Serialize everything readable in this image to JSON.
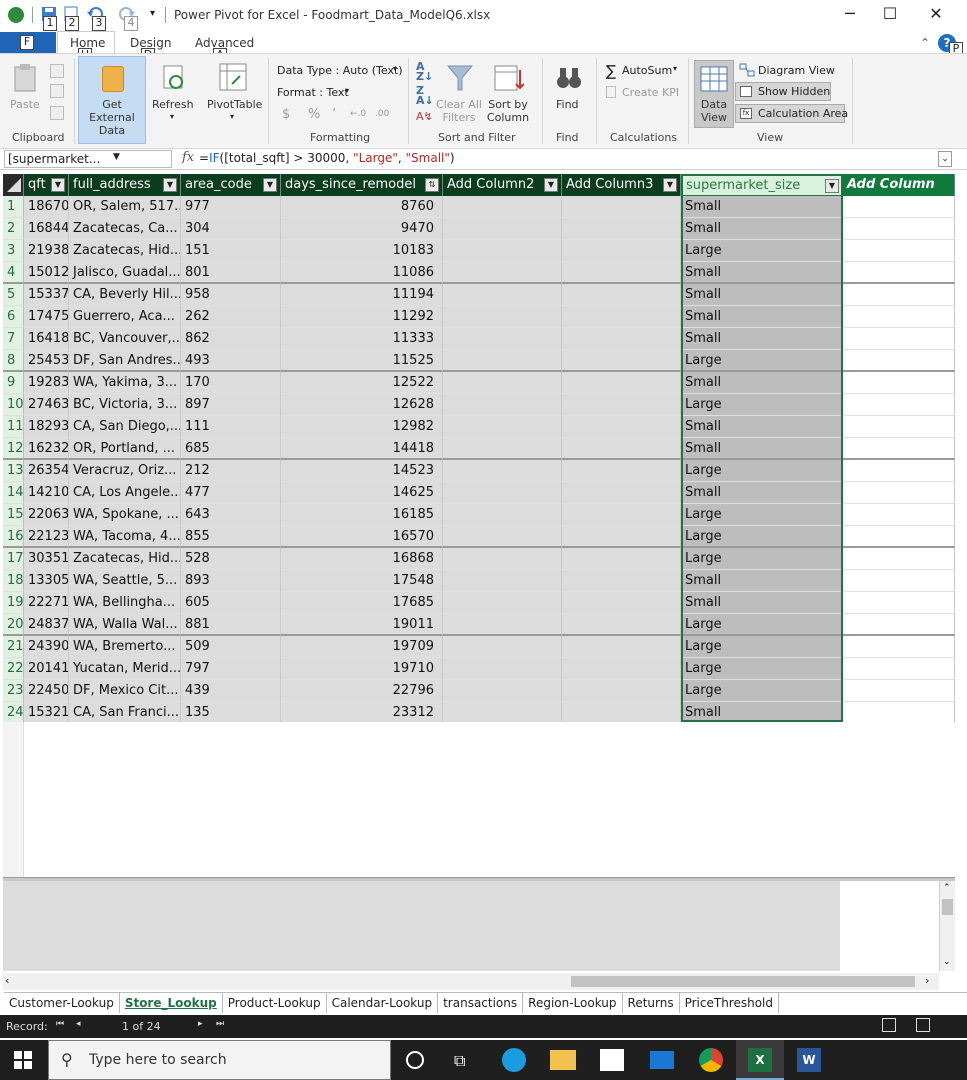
{
  "window": {
    "title": "Power Pivot for Excel - Foodmart_Data_ModelQ6.xlsx",
    "keytips": [
      "1",
      "2",
      "3",
      "4"
    ],
    "controls": {
      "minimize": "─",
      "maximize": "☐",
      "close": "✕"
    }
  },
  "tabs": {
    "file": "F",
    "items": [
      {
        "label": "Home",
        "keytip": "H"
      },
      {
        "label": "Design",
        "keytip": "D"
      },
      {
        "label": "Advanced",
        "keytip": "A"
      }
    ],
    "help_keytip": "P"
  },
  "ribbon": {
    "clipboard": {
      "paste": "Paste",
      "group": "Clipboard"
    },
    "get_data": {
      "get_external": "Get External Data",
      "refresh": "Refresh",
      "pivot": "PivotTable"
    },
    "formatting": {
      "data_type": "Data Type : Auto (Text)",
      "format": "Format : Text",
      "group": "Formatting",
      "symbols": [
        "$",
        "%",
        "’",
        "←.0",
        ".00"
      ]
    },
    "sort_filter": {
      "clear": "Clear All Filters",
      "sort_by": "Sort by Column",
      "group": "Sort and Filter"
    },
    "find": {
      "find": "Find",
      "group": "Find"
    },
    "calculations": {
      "autosum": "AutoSum",
      "create_kpi": "Create KPI",
      "group": "Calculations"
    },
    "view": {
      "data_view": "Data View",
      "diagram": "Diagram View",
      "show_hidden": "Show Hidden",
      "calc_area": "Calculation Area",
      "group": "View"
    }
  },
  "formula_bar": {
    "name_box": "[supermarket...",
    "fx": "fx",
    "formula_prefix": "=",
    "formula_fn": "IF",
    "formula_mid": "([total_sqft] > 30000, ",
    "formula_str1": "\"Large\"",
    "formula_sep": ", ",
    "formula_str2": "\"Small\"",
    "formula_end": ")"
  },
  "table": {
    "columns": [
      "qft",
      "full_address",
      "area_code",
      "days_since_remodel",
      "Add Column2",
      "Add Column3",
      "supermarket_size",
      "Add Column"
    ],
    "rows": [
      [
        "1",
        "18670",
        "OR, Salem, 517...",
        "977",
        "8760",
        "Small"
      ],
      [
        "2",
        "16844",
        "Zacatecas, Ca...",
        "304",
        "9470",
        "Small"
      ],
      [
        "3",
        "21938",
        "Zacatecas, Hid...",
        "151",
        "10183",
        "Large"
      ],
      [
        "4",
        "15012",
        "Jalisco, Guadal...",
        "801",
        "11086",
        "Small"
      ],
      [
        "5",
        "15337",
        "CA, Beverly Hil...",
        "958",
        "11194",
        "Small"
      ],
      [
        "6",
        "17475",
        "Guerrero, Aca...",
        "262",
        "11292",
        "Small"
      ],
      [
        "7",
        "16418",
        "BC, Vancouver,...",
        "862",
        "11333",
        "Small"
      ],
      [
        "8",
        "25453",
        "DF, San Andres...",
        "493",
        "11525",
        "Large"
      ],
      [
        "9",
        "19283",
        "WA, Yakima, 3...",
        "170",
        "12522",
        "Small"
      ],
      [
        "10",
        "27463",
        "BC, Victoria, 3...",
        "897",
        "12628",
        "Large"
      ],
      [
        "11",
        "18293",
        "CA, San Diego,...",
        "111",
        "12982",
        "Small"
      ],
      [
        "12",
        "16232",
        "OR, Portland, ...",
        "685",
        "14418",
        "Small"
      ],
      [
        "13",
        "26354",
        "Veracruz, Oriz...",
        "212",
        "14523",
        "Large"
      ],
      [
        "14",
        "14210",
        "CA, Los Angele...",
        "477",
        "14625",
        "Small"
      ],
      [
        "15",
        "22063",
        "WA, Spokane, ...",
        "643",
        "16185",
        "Large"
      ],
      [
        "16",
        "22123",
        "WA, Tacoma, 4...",
        "855",
        "16570",
        "Large"
      ],
      [
        "17",
        "30351",
        "Zacatecas, Hid...",
        "528",
        "16868",
        "Large"
      ],
      [
        "18",
        "13305",
        "WA, Seattle, 5...",
        "893",
        "17548",
        "Small"
      ],
      [
        "19",
        "22271",
        "WA, Bellingha...",
        "605",
        "17685",
        "Small"
      ],
      [
        "20",
        "24837",
        "WA, Walla Wal...",
        "881",
        "19011",
        "Large"
      ],
      [
        "21",
        "24390",
        "WA, Bremerto...",
        "509",
        "19709",
        "Large"
      ],
      [
        "22",
        "20141",
        "Yucatan, Merid...",
        "797",
        "19710",
        "Large"
      ],
      [
        "23",
        "22450",
        "DF, Mexico Cit...",
        "439",
        "22796",
        "Large"
      ],
      [
        "24",
        "15321",
        "CA, San Franci...",
        "135",
        "23312",
        "Small"
      ]
    ]
  },
  "sheet_tabs": [
    "Customer-Lookup",
    "Store_Lookup",
    "Product-Lookup",
    "Calendar-Lookup",
    "transactions",
    "Region-Lookup",
    "Returns",
    "PriceThreshold"
  ],
  "active_sheet": "Store_Lookup",
  "status": {
    "record_label": "Record:",
    "record_pos": "1 of 24"
  },
  "taskbar": {
    "search_placeholder": "Type here to search"
  },
  "colors": {
    "accent": "#217346",
    "header_bg": "#0b3d1f",
    "file_tab": "#2066b8"
  }
}
